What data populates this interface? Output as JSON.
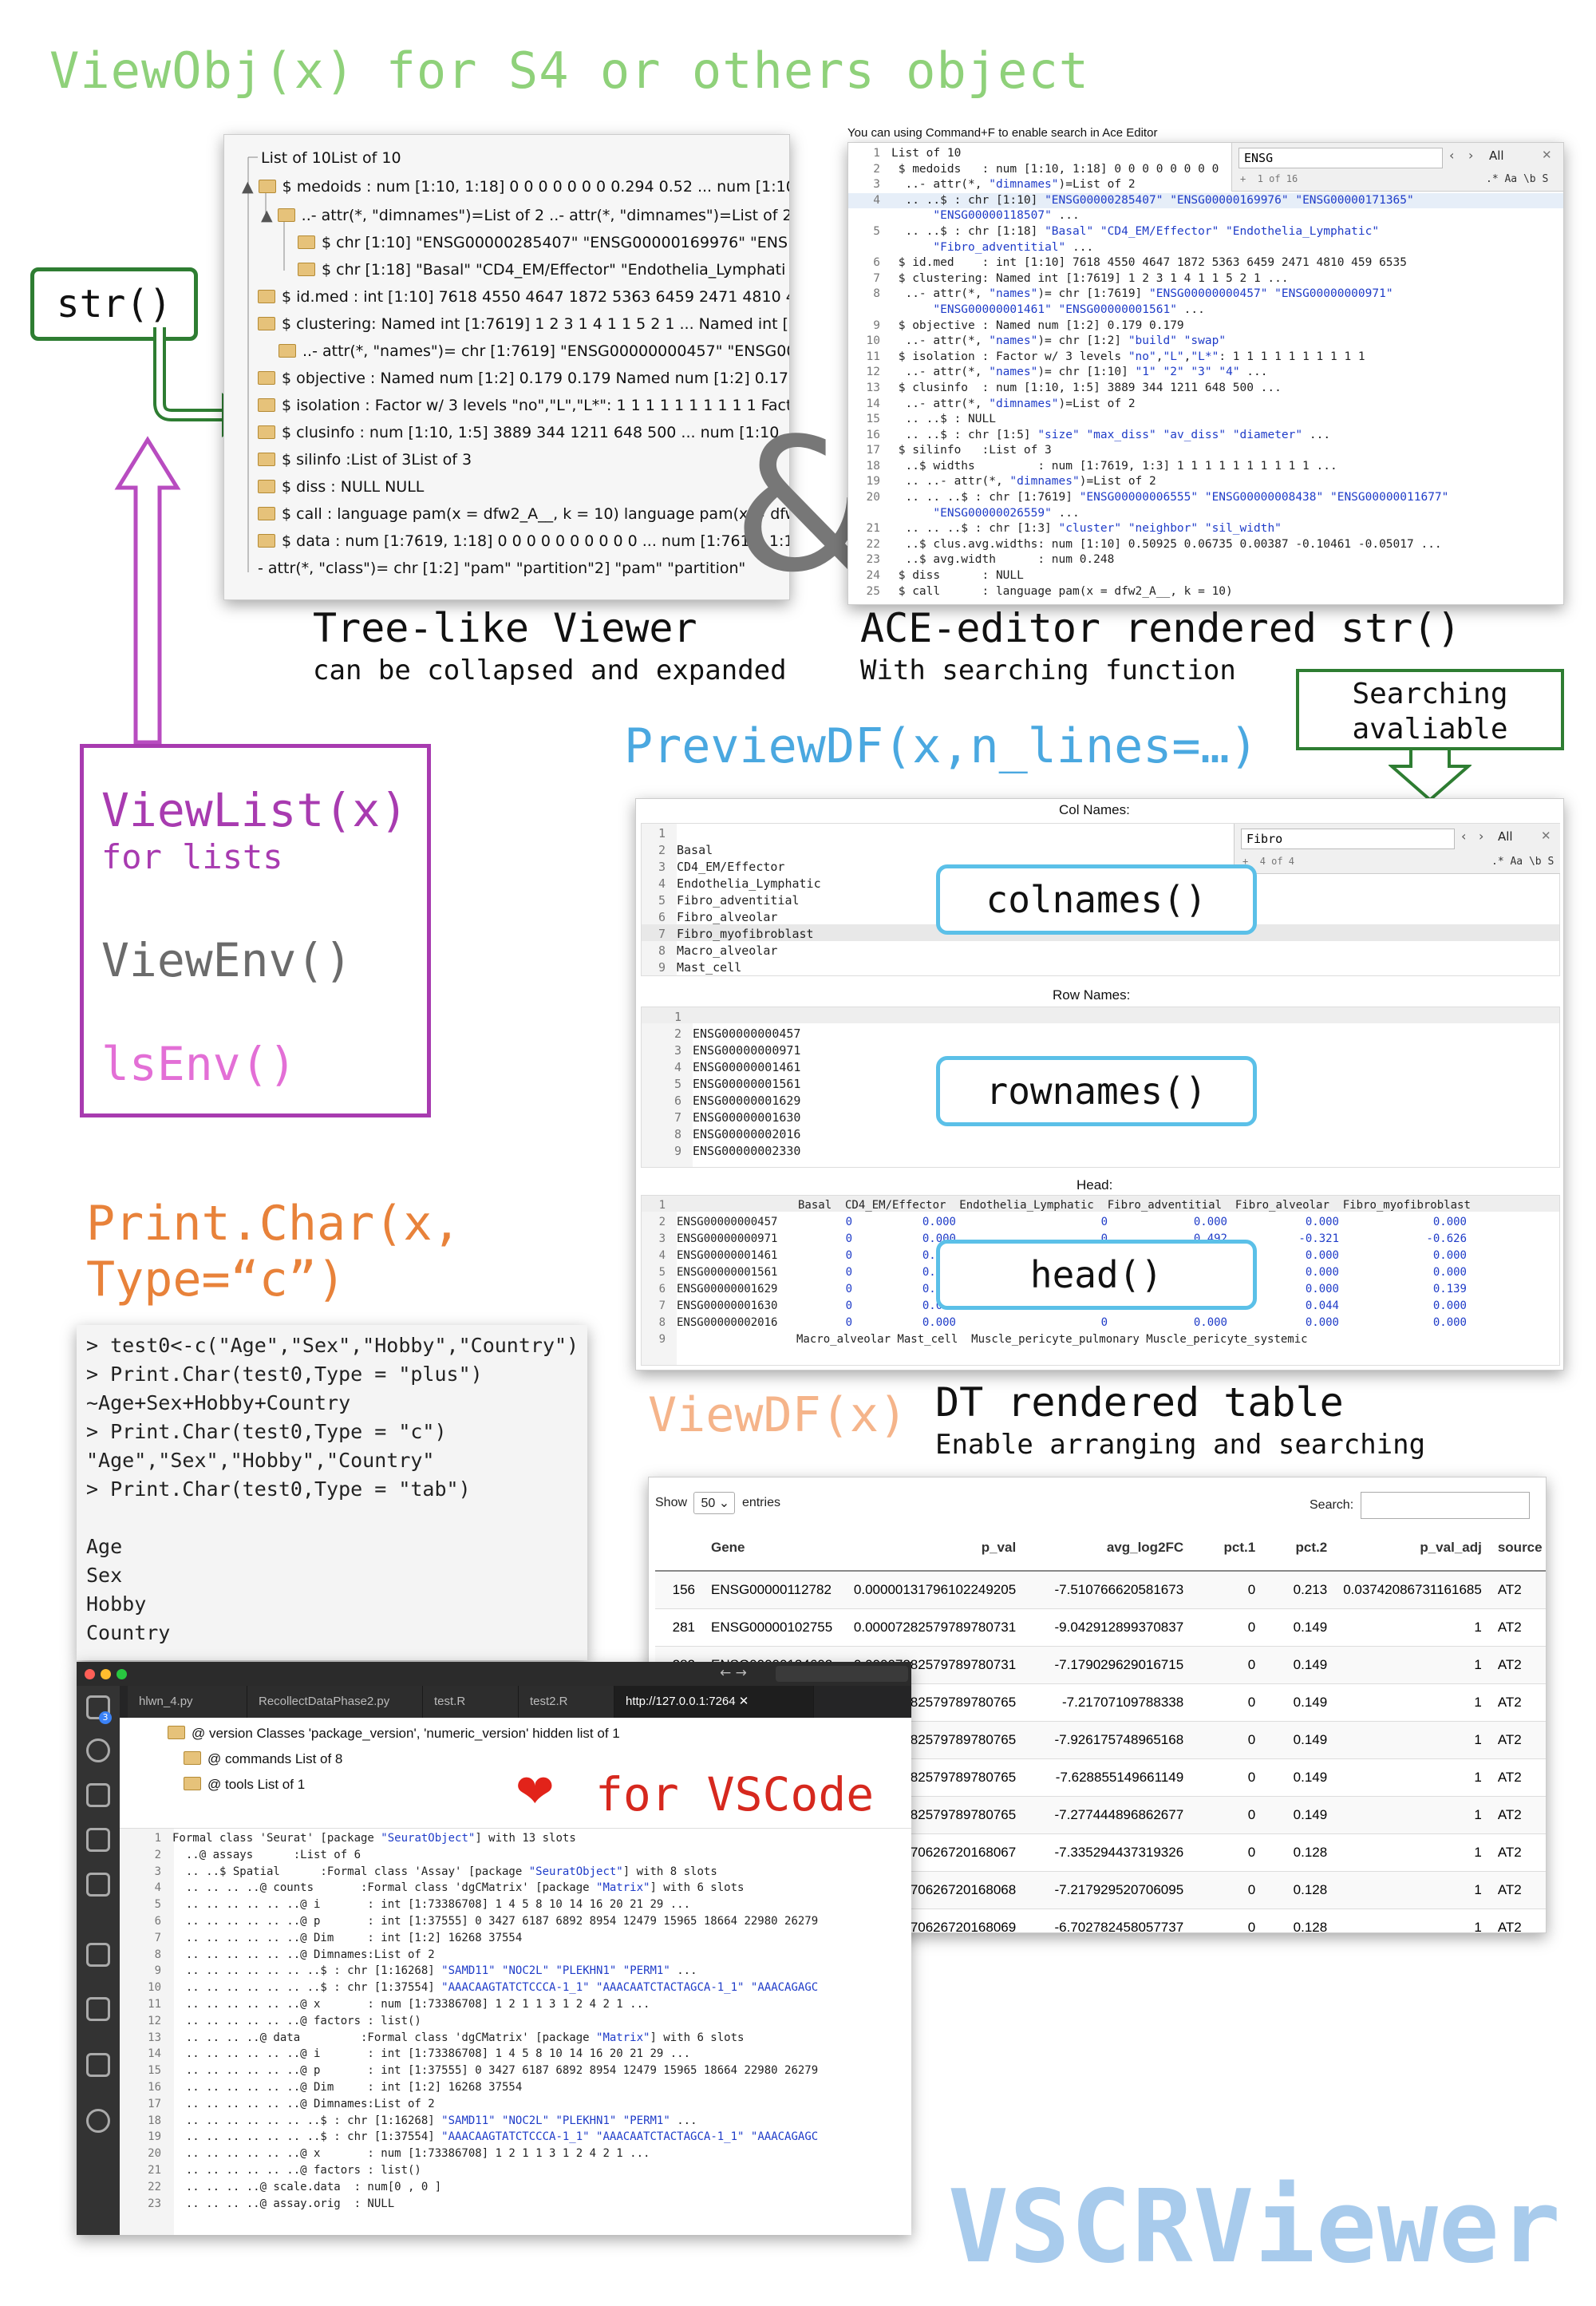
{
  "headline": "ViewObj(x) for S4 or others object",
  "str_box": "str()",
  "tree": {
    "rows": [
      "List of 10List of 10",
      "$ medoids : num [1:10, 1:18] 0 0 0 0 0 0 0 0.294 0.52 ... num [1:10,",
      "..- attr(*, \"dimnames\")=List of 2 ..- attr(*, \"dimnames\")=List of 2.0",
      "$ chr [1:10] \"ENSG00000285407\" \"ENSG00000169976\" \"ENS",
      "$ chr [1:18] \"Basal\" \"CD4_EM/Effector\" \"Endothelia_Lymphati",
      "$ id.med : int [1:10] 7618 4550 4647 1872 5363 6459 2471 4810 459",
      "$ clustering: Named int [1:7619] 1 2 3 1 4 1 1 5 2 1 ... Named int [1:7",
      "..- attr(*, \"names\")= chr [1:7619] \"ENSG00000000457\" \"ENSG000",
      "$ objective : Named num [1:2] 0.179 0.179 Named num [1:2] 0.179 0.",
      "$ isolation : Factor w/ 3 levels \"no\",\"L\",\"L*\": 1 1 1 1 1 1 1 1 1 1 Facto",
      "$ clusinfo : num [1:10, 1:5] 3889 344 1211 648 500 ... num [1:10, 1:5",
      "$ silinfo :List of 3List of 3",
      "$ diss : NULL NULL",
      "$ call : language pam(x = dfw2_A__, k = 10) language pam(x = dfw2_",
      "$ data : num [1:7619, 1:18] 0 0 0 0 0 0 0 0 0 0 ... num [1:7619, 1:18] 0",
      "- attr(*, \"class\")= chr [1:2] \"pam\" \"partition\"2] \"pam\" \"partition\""
    ],
    "caption": "Tree-like Viewer",
    "subcaption": "can be collapsed and expanded"
  },
  "ampersand": "&",
  "ace": {
    "hint": "You can using Command+F to enable search in Ace Editor",
    "search_value": "ENSG",
    "search_count": "1 of 16",
    "search_all": "All",
    "search_opts": ".* Aa \\b S",
    "lines": [
      [
        "1",
        "List of 10"
      ],
      [
        "2",
        " $ medoids   : num [1:10, 1:18] 0 0 0 0 0 0 0 0"
      ],
      [
        "3",
        "  ..- attr(*, \"dimnames\")=List of 2"
      ],
      [
        "4",
        "  .. ..$ : chr [1:10] \"ENSG00000285407\" \"ENSG00000169976\" \"ENSG00000171365\""
      ],
      [
        "",
        "      \"ENSG00000118507\" ..."
      ],
      [
        "5",
        "  .. ..$ : chr [1:18] \"Basal\" \"CD4_EM/Effector\" \"Endothelia_Lymphatic\""
      ],
      [
        "",
        "      \"Fibro_adventitial\" ..."
      ],
      [
        "6",
        " $ id.med    : int [1:10] 7618 4550 4647 1872 5363 6459 2471 4810 459 6535"
      ],
      [
        "7",
        " $ clustering: Named int [1:7619] 1 2 3 1 4 1 1 5 2 1 ..."
      ],
      [
        "8",
        "  ..- attr(*, \"names\")= chr [1:7619] \"ENSG00000000457\" \"ENSG00000000971\""
      ],
      [
        "",
        "      \"ENSG00000001461\" \"ENSG00000001561\" ..."
      ],
      [
        "9",
        " $ objective : Named num [1:2] 0.179 0.179"
      ],
      [
        "10",
        "  ..- attr(*, \"names\")= chr [1:2] \"build\" \"swap\""
      ],
      [
        "11",
        " $ isolation : Factor w/ 3 levels \"no\",\"L\",\"L*\": 1 1 1 1 1 1 1 1 1 1"
      ],
      [
        "12",
        "  ..- attr(*, \"names\")= chr [1:10] \"1\" \"2\" \"3\" \"4\" ..."
      ],
      [
        "13",
        " $ clusinfo  : num [1:10, 1:5] 3889 344 1211 648 500 ..."
      ],
      [
        "14",
        "  ..- attr(*, \"dimnames\")=List of 2"
      ],
      [
        "15",
        "  .. ..$ : NULL"
      ],
      [
        "16",
        "  .. ..$ : chr [1:5] \"size\" \"max_diss\" \"av_diss\" \"diameter\" ..."
      ],
      [
        "17",
        " $ silinfo   :List of 3"
      ],
      [
        "18",
        "  ..$ widths         : num [1:7619, 1:3] 1 1 1 1 1 1 1 1 1 1 ..."
      ],
      [
        "19",
        "  .. ..- attr(*, \"dimnames\")=List of 2"
      ],
      [
        "20",
        "  .. .. ..$ : chr [1:7619] \"ENSG00000006555\" \"ENSG00000008438\" \"ENSG00000011677\""
      ],
      [
        "",
        "      \"ENSG00000026559\" ..."
      ],
      [
        "21",
        "  .. .. ..$ : chr [1:3] \"cluster\" \"neighbor\" \"sil_width\""
      ],
      [
        "22",
        "  ..$ clus.avg.widths: num [1:10] 0.50925 0.06735 0.00387 -0.10461 -0.05017 ..."
      ],
      [
        "23",
        "  ..$ avg.width      : num 0.248"
      ],
      [
        "24",
        " $ diss      : NULL"
      ],
      [
        "25",
        " $ call      : language pam(x = dfw2_A__, k = 10)"
      ]
    ],
    "caption": "ACE-editor rendered str()",
    "subcaption": "With searching function"
  },
  "searching_note": "Searching avaliable",
  "viewlist": {
    "title": "ViewList(x)",
    "sub": "for lists",
    "env": "ViewEnv()",
    "ls": "lsEnv()"
  },
  "preview": {
    "title": "PreviewDF(x,n_lines=…)",
    "col_header": "Col Names:",
    "col_lines": [
      "",
      "Basal",
      "CD4_EM/Effector",
      "Endothelia_Lymphatic",
      "Fibro_adventitial",
      "Fibro_alveolar",
      "Fibro_myofibroblast",
      "Macro_alveolar",
      "Mast_cell"
    ],
    "search_value": "Fibro",
    "search_count": "4 of 4",
    "search_all": "All",
    "search_opts": ".* Aa \\b S",
    "row_header": "Row Names:",
    "row_lines": [
      "",
      "ENSG00000000457",
      "ENSG00000000971",
      "ENSG00000001461",
      "ENSG00000001561",
      "ENSG00000001629",
      "ENSG00000001630",
      "ENSG00000002016",
      "ENSG00000002330"
    ],
    "head_header": "Head:",
    "head_cols": "Basal  CD4_EM/Effector  Endothelia_Lymphatic  Fibro_adventitial  Fibro_alveolar  Fibro_myofibroblast",
    "head_rows": [
      [
        "ENSG00000000457",
        "0",
        "0.000",
        "0",
        "0.000",
        "0.000",
        "0.000"
      ],
      [
        "ENSG00000000971",
        "0",
        "0.000",
        "0",
        "0.492",
        "-0.321",
        "-0.626"
      ],
      [
        "ENSG00000001461",
        "0",
        "0.000",
        "0",
        "0.000",
        "0.000",
        "0.000"
      ],
      [
        "ENSG00000001561",
        "0",
        "0.000",
        "0",
        "0.000",
        "0.000",
        "0.000"
      ],
      [
        "ENSG00000001629",
        "0",
        "0.000",
        "0",
        "0.000",
        "0.000",
        "0.139"
      ],
      [
        "ENSG00000001630",
        "0",
        "0.000",
        "0",
        "0.000",
        "0.044",
        "0.000"
      ],
      [
        "ENSG00000002016",
        "0",
        "0.000",
        "0",
        "0.000",
        "0.000",
        "0.000"
      ]
    ],
    "head_footer": "Macro_alveolar Mast_cell  Muscle_pericyte_pulmonary Muscle_pericyte_systemic",
    "callout_colnames": "colnames()",
    "callout_rownames": "rownames()",
    "callout_head": "head()"
  },
  "printchar": {
    "title1": "Print.Char(x,",
    "title2": "Type=“c”)",
    "console": [
      "> test0<-c(\"Age\",\"Sex\",\"Hobby\",\"Country\")",
      "> Print.Char(test0,Type = \"plus\")",
      "~Age+Sex+Hobby+Country",
      "> Print.Char(test0,Type = \"c\")",
      "\"Age\",\"Sex\",\"Hobby\",\"Country\"",
      "> Print.Char(test0,Type = \"tab\")",
      "",
      "Age",
      "Sex",
      "Hobby",
      "Country"
    ]
  },
  "viewdf": {
    "title": "ViewDF(x)",
    "caption": "DT rendered table",
    "subcaption": "Enable arranging and searching",
    "show_label": "Show",
    "show_value": "50",
    "entries_label": "entries",
    "search_label": "Search:",
    "columns": [
      "",
      "Gene",
      "p_val",
      "avg_log2FC",
      "pct.1",
      "pct.2",
      "p_val_adj",
      "source"
    ],
    "rows": [
      [
        "156",
        "ENSG00000112782",
        "0.00000131796102249205",
        "-7.510766620581673",
        "0",
        "0.213",
        "0.03742086731161685",
        "AT2"
      ],
      [
        "281",
        "ENSG00000102755",
        "0.00007282579789780731",
        "-9.042912899370837",
        "0",
        "0.149",
        "1",
        "AT2"
      ],
      [
        "282",
        "ENSG00000134602",
        "0.00007282579789780731",
        "-7.179029629016715",
        "0",
        "0.149",
        "1",
        "AT2"
      ],
      [
        "",
        "",
        "0.00007282579789780765",
        "-7.21707109788338",
        "0",
        "0.149",
        "1",
        "AT2"
      ],
      [
        "",
        "",
        "0.00007282579789780765",
        "-7.926175748965168",
        "0",
        "0.149",
        "1",
        "AT2"
      ],
      [
        "",
        "",
        "0.00007282579789780765",
        "-7.628855149661149",
        "0",
        "0.149",
        "1",
        "AT2"
      ],
      [
        "",
        "",
        "0.00007282579789780765",
        "-7.277444896862677",
        "0",
        "0.149",
        "1",
        "AT2"
      ],
      [
        "",
        "",
        "0.00070626720168067",
        "-7.335294437319326",
        "0",
        "0.128",
        "1",
        "AT2"
      ],
      [
        "",
        "",
        "0.00070626720168068",
        "-7.217929520706095",
        "0",
        "0.128",
        "1",
        "AT2"
      ],
      [
        "",
        "",
        "0.00070626720168069",
        "-6.702782458057737",
        "0",
        "0.128",
        "1",
        "AT2"
      ]
    ]
  },
  "vscode": {
    "tabs": [
      "hlwn_4.py",
      "RecollectDataPhase2.py",
      "test.R",
      "test2.R",
      "http://127.0.0.1:7264"
    ],
    "badge": "3",
    "tree_rows": [
      "@ version Classes 'package_version', 'numeric_version' hidden list of 1",
      "@ commands List of 8",
      "@ tools List of 1"
    ],
    "heart_label": "for VSCode",
    "lines": [
      [
        "1",
        "Formal class 'Seurat' [package \"SeuratObject\"] with 13 slots"
      ],
      [
        "2",
        "  ..@ assays      :List of 6"
      ],
      [
        "3",
        "  .. ..$ Spatial      :Formal class 'Assay' [package \"SeuratObject\"] with 8 slots"
      ],
      [
        "4",
        "  .. .. .. ..@ counts       :Formal class 'dgCMatrix' [package \"Matrix\"] with 6 slots"
      ],
      [
        "5",
        "  .. .. .. .. .. ..@ i       : int [1:73386708] 1 4 5 8 10 14 16 20 21 29 ..."
      ],
      [
        "6",
        "  .. .. .. .. .. ..@ p       : int [1:37555] 0 3427 6187 6892 8954 12479 15965 18664 22980 26279"
      ],
      [
        "7",
        "  .. .. .. .. .. ..@ Dim     : int [1:2] 16268 37554"
      ],
      [
        "8",
        "  .. .. .. .. .. ..@ Dimnames:List of 2"
      ],
      [
        "9",
        "  .. .. .. .. .. .. ..$ : chr [1:16268] \"SAMD11\" \"NOC2L\" \"PLEKHN1\" \"PERM1\" ..."
      ],
      [
        "10",
        "  .. .. .. .. .. .. ..$ : chr [1:37554] \"AAACAAGTATCTCCCA-1_1\" \"AAACAATCTACTAGCA-1_1\" \"AAACAGAGC"
      ],
      [
        "11",
        "  .. .. .. .. .. ..@ x       : num [1:73386708] 1 2 1 1 3 1 2 4 2 1 ..."
      ],
      [
        "12",
        "  .. .. .. .. .. ..@ factors : list()"
      ],
      [
        "13",
        "  .. .. .. ..@ data         :Formal class 'dgCMatrix' [package \"Matrix\"] with 6 slots"
      ],
      [
        "14",
        "  .. .. .. .. .. ..@ i       : int [1:73386708] 1 4 5 8 10 14 16 20 21 29 ..."
      ],
      [
        "15",
        "  .. .. .. .. .. ..@ p       : int [1:37555] 0 3427 6187 6892 8954 12479 15965 18664 22980 26279"
      ],
      [
        "16",
        "  .. .. .. .. .. ..@ Dim     : int [1:2] 16268 37554"
      ],
      [
        "17",
        "  .. .. .. .. .. ..@ Dimnames:List of 2"
      ],
      [
        "18",
        "  .. .. .. .. .. .. ..$ : chr [1:16268] \"SAMD11\" \"NOC2L\" \"PLEKHN1\" \"PERM1\" ..."
      ],
      [
        "19",
        "  .. .. .. .. .. .. ..$ : chr [1:37554] \"AAACAAGTATCTCCCA-1_1\" \"AAACAATCTACTAGCA-1_1\" \"AAACAGAGC"
      ],
      [
        "20",
        "  .. .. .. .. .. ..@ x       : num [1:73386708] 1 2 1 1 3 1 2 4 2 1 ..."
      ],
      [
        "21",
        "  .. .. .. .. .. ..@ factors : list()"
      ],
      [
        "22",
        "  .. .. .. ..@ scale.data  : num[0 , 0 ]"
      ],
      [
        "23",
        "  .. .. .. ..@ assay.orig  : NULL"
      ]
    ]
  },
  "brand": "VSCRViewer",
  "colors": {
    "green_title": "#8fd17a",
    "dark_green": "#2e7d32",
    "purple": "#a83bb0",
    "purple_arrow": "#b84cc0",
    "gray_text": "#6b6b6b",
    "pink": "#e36fd6",
    "orange": "#e8823a",
    "light_orange": "#f5b48a",
    "blue_title": "#4aa8e0",
    "brand_blue": "#a8cbec",
    "callout_border": "#5bc0e8"
  }
}
